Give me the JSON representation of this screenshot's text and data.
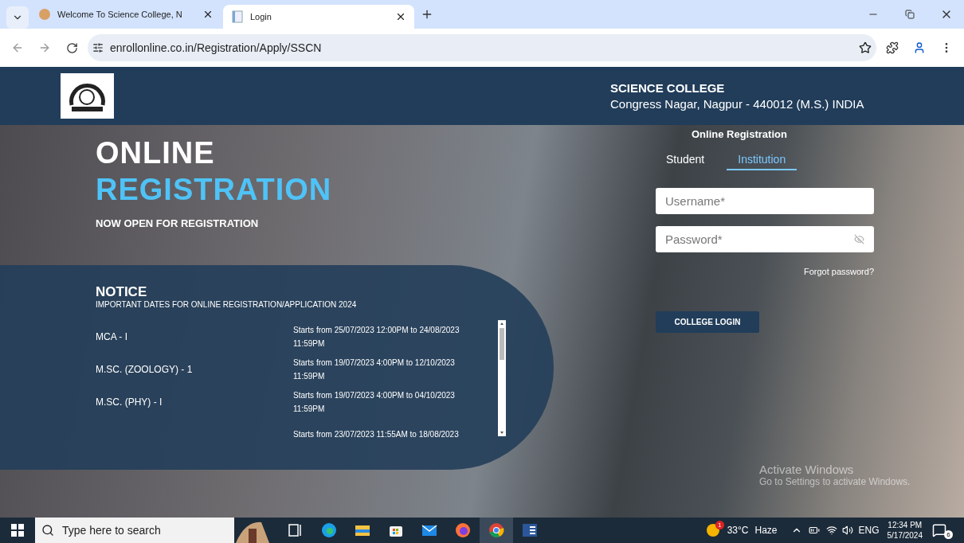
{
  "browser": {
    "tabs": [
      {
        "title": "Welcome To Science College, N",
        "selected": false
      },
      {
        "title": "Login",
        "selected": true
      }
    ],
    "url": "enrollonline.co.in/Registration/Apply/SSCN"
  },
  "header": {
    "college_name": "SCIENCE COLLEGE",
    "address": "Congress Nagar, Nagpur - 440012 (M.S.) INDIA"
  },
  "hero": {
    "title_line1": "ONLINE",
    "title_line2": "REGISTRATION",
    "subtitle": "NOW OPEN FOR REGISTRATION"
  },
  "notice": {
    "heading": "NOTICE",
    "subheading": "IMPORTANT DATES FOR ONLINE REGISTRATION/APPLICATION 2024",
    "rows": [
      {
        "course": "MCA - I",
        "dates": "Starts from 25/07/2023 12:00PM to 24/08/2023 11:59PM"
      },
      {
        "course": "M.SC. (ZOOLOGY) - 1",
        "dates": "Starts from 19/07/2023 4:00PM to 12/10/2023 11:59PM"
      },
      {
        "course": "M.SC. (PHY) - I",
        "dates": "Starts from 19/07/2023 4:00PM to 04/10/2023 11:59PM"
      },
      {
        "dates": "Starts from 23/07/2023 11:55AM to 18/08/2023"
      }
    ]
  },
  "form": {
    "heading": "Online Registration",
    "tabs": [
      {
        "label": "Student",
        "selected": false
      },
      {
        "label": "Institution",
        "selected": true
      }
    ],
    "username": {
      "placeholder": "Username*"
    },
    "password": {
      "placeholder": "Password*"
    },
    "forgot_link": "Forgot password?",
    "login_button": "COLLEGE LOGIN"
  },
  "activation_notice": {
    "title": "Activate Windows",
    "subtitle": "Go to Settings to activate Windows."
  },
  "taskbar": {
    "search_placeholder": "Type here to search",
    "apps": [
      {
        "kind": "taskview",
        "selected": false
      },
      {
        "kind": "edge",
        "selected": false
      },
      {
        "kind": "files",
        "selected": false
      },
      {
        "kind": "store",
        "selected": false
      },
      {
        "kind": "mail",
        "selected": false
      },
      {
        "kind": "firefox",
        "selected": false
      },
      {
        "kind": "chrome",
        "selected": true
      },
      {
        "kind": "word",
        "selected": false
      }
    ],
    "weather_badge": "1",
    "temperature": "33°C",
    "condition": "Haze",
    "language": "ENG",
    "time": "12:34 PM",
    "date": "5/17/2024",
    "notification_count": "6"
  }
}
